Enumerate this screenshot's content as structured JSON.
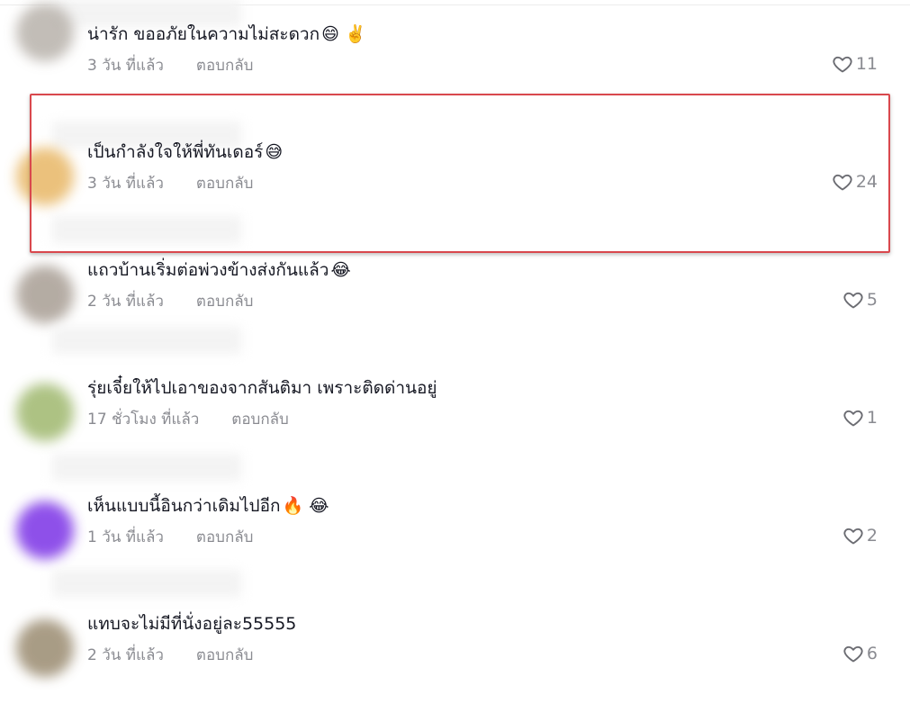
{
  "comments": [
    {
      "text": "น่ารัก ขออภัยในความไม่สะดวก",
      "emoji": "😄 ✌️",
      "time": "3 วัน ที่แล้ว",
      "reply": "ตอบกลับ",
      "likes": "11",
      "avatar_color": "#b8b2ab"
    },
    {
      "text": "เป็นกำลังใจให้พี่ทันเดอร์",
      "emoji": "😅",
      "time": "3 วัน ที่แล้ว",
      "reply": "ตอบกลับ",
      "likes": "24",
      "avatar_color": "#e8b766"
    },
    {
      "text": "แถวบ้านเริ่มต่อพ่วงข้างส่งกันแล้ว",
      "emoji": "😂",
      "time": "2 วัน ที่แล้ว",
      "reply": "ตอบกลับ",
      "likes": "5",
      "avatar_color": "#a89e94"
    },
    {
      "text": "รุ่ยเจี๋ยให้ไปเอาของจากสันติมา เพราะติดด่านอยู่",
      "emoji": "",
      "time": "17 ชั่วโมง ที่แล้ว",
      "reply": "ตอบกลับ",
      "likes": "1",
      "avatar_color": "#9fb86e"
    },
    {
      "text": "เห็นแบบนี้อินกว่าเดิมไปอีก",
      "emoji": "🔥 😂",
      "time": "1 วัน ที่แล้ว",
      "reply": "ตอบกลับ",
      "likes": "2",
      "avatar_color": "#7b32e6"
    },
    {
      "text": "แทบจะไม่มีที่นั่งอยู่ละ55555",
      "emoji": "",
      "time": "2 วัน ที่แล้ว",
      "reply": "ตอบกลับ",
      "likes": "6",
      "avatar_color": "#9a8b70"
    }
  ],
  "highlight_color": "#d9484d"
}
